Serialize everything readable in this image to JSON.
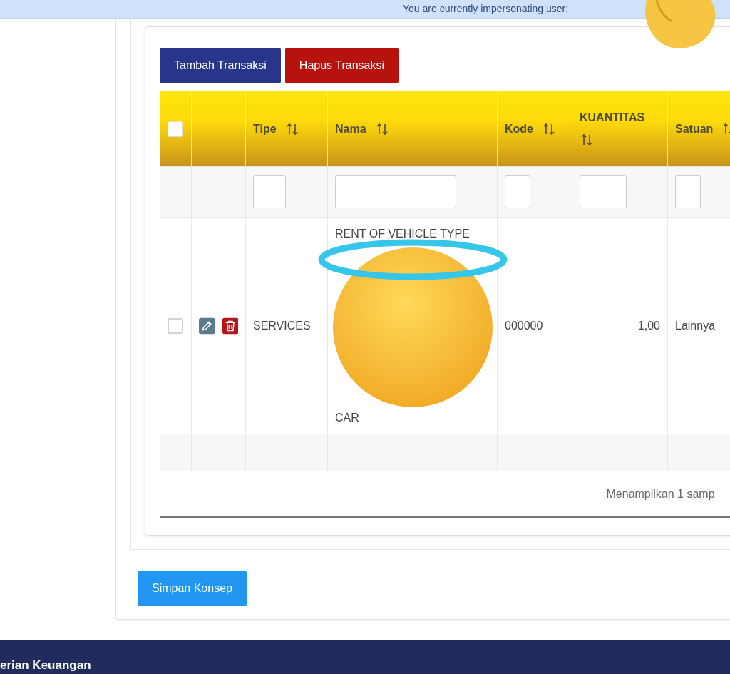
{
  "banner": {
    "text": "You are currently impersonating user:"
  },
  "buttons": [
    {
      "label": "Tambah Transaksi",
      "kind": "primary"
    },
    {
      "label": "Hapus Transaksi",
      "kind": "danger"
    }
  ],
  "table": {
    "select_all": {
      "checked": false
    },
    "columns": [
      {
        "label": "Tipe"
      },
      {
        "label": "Nama"
      },
      {
        "label": "Kode"
      },
      {
        "label": "KUANTITAS"
      },
      {
        "label": "Satuan"
      }
    ],
    "rows": [
      {
        "checked": false,
        "tipe": "SERVICES",
        "nama": [
          "RENT OF VEHICLE TYPE",
          "CAR"
        ],
        "kode": "000000",
        "kuantitas": "1,00",
        "satuan": "Lainnya"
      }
    ],
    "footer": "Menampilkan 1 samp"
  },
  "save_button": {
    "label": "Simpan Konsep"
  },
  "site_footer": {
    "text": "erian Keuangan"
  }
}
